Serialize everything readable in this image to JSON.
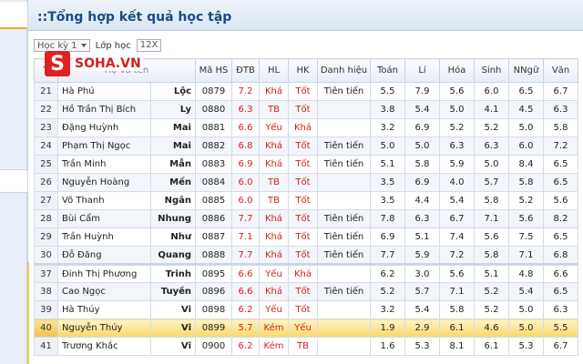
{
  "title": "::Tổng hợp kết quả học tập",
  "toolbar": {
    "semester_label": "Học kỳ 1",
    "class_label": "Lớp học",
    "class_value": "12X"
  },
  "logo": {
    "letter": "S",
    "text": "SOHA.VN"
  },
  "columns": {
    "stt": "T",
    "name": "Họ và tên",
    "ma_hs": "Mã HS",
    "dtb": "ĐTB",
    "hl": "HL",
    "hk": "HK",
    "danh_hieu": "Danh hiệu",
    "toan": "Toán",
    "li": "Lí",
    "hoa": "Hóa",
    "sinh": "Sinh",
    "nngu": "NNgữ",
    "van": "Văn"
  },
  "rows": [
    {
      "stt": "21",
      "ho": "Hà Phú",
      "ten": "Lộc",
      "ma": "0879",
      "dtb": "7.2",
      "hl": "Khá",
      "hk": "Tốt",
      "dh": "Tiên tiến",
      "toan": "5.5",
      "li": "7.9",
      "hoa": "5.6",
      "sinh": "6.0",
      "nngu": "6.5",
      "van": "6.7"
    },
    {
      "stt": "22",
      "ho": "Hồ Trần Thị Bích",
      "ten": "Ly",
      "ma": "0880",
      "dtb": "6.3",
      "hl": "TB",
      "hk": "Tốt",
      "dh": "",
      "toan": "3.8",
      "li": "5.4",
      "hoa": "5.0",
      "sinh": "4.1",
      "nngu": "4.5",
      "van": "6.3"
    },
    {
      "stt": "23",
      "ho": "Đặng Huỳnh",
      "ten": "Mai",
      "ma": "0881",
      "dtb": "6.6",
      "hl": "Yếu",
      "hk": "Khá",
      "dh": "",
      "toan": "3.2",
      "li": "6.9",
      "hoa": "5.2",
      "sinh": "5.2",
      "nngu": "5.0",
      "van": "5.8"
    },
    {
      "stt": "24",
      "ho": "Phạm Thị Ngọc",
      "ten": "Mai",
      "ma": "0882",
      "dtb": "6.8",
      "hl": "Khá",
      "hk": "Tốt",
      "dh": "Tiên tiến",
      "toan": "5.0",
      "li": "5.0",
      "hoa": "6.3",
      "sinh": "6.3",
      "nngu": "6.0",
      "van": "7.2"
    },
    {
      "stt": "25",
      "ho": "Trần Minh",
      "ten": "Mẫn",
      "ma": "0883",
      "dtb": "6.9",
      "hl": "Khá",
      "hk": "Tốt",
      "dh": "Tiên tiến",
      "toan": "5.1",
      "li": "5.8",
      "hoa": "5.9",
      "sinh": "5.0",
      "nngu": "8.4",
      "van": "6.5"
    },
    {
      "stt": "26",
      "ho": "Nguyễn Hoàng",
      "ten": "Mến",
      "ma": "0884",
      "dtb": "6.0",
      "hl": "TB",
      "hk": "Tốt",
      "dh": "",
      "toan": "3.5",
      "li": "6.9",
      "hoa": "4.0",
      "sinh": "5.7",
      "nngu": "5.8",
      "van": "6.5"
    },
    {
      "stt": "27",
      "ho": "Võ Thanh",
      "ten": "Ngân",
      "ma": "0885",
      "dtb": "6.0",
      "hl": "TB",
      "hk": "Tốt",
      "dh": "",
      "toan": "3.5",
      "li": "4.4",
      "hoa": "5.4",
      "sinh": "5.8",
      "nngu": "5.2",
      "van": "5.6"
    },
    {
      "stt": "28",
      "ho": "Bùi Cẩm",
      "ten": "Nhung",
      "ma": "0886",
      "dtb": "7.7",
      "hl": "Khá",
      "hk": "Tốt",
      "dh": "Tiên tiến",
      "toan": "7.8",
      "li": "6.3",
      "hoa": "6.7",
      "sinh": "7.1",
      "nngu": "5.6",
      "van": "8.2"
    },
    {
      "stt": "29",
      "ho": "Trần Huỳnh",
      "ten": "Như",
      "ma": "0887",
      "dtb": "7.1",
      "hl": "Khá",
      "hk": "Tốt",
      "dh": "Tiên tiến",
      "toan": "6.9",
      "li": "5.1",
      "hoa": "7.4",
      "sinh": "5.6",
      "nngu": "7.5",
      "van": "6.5"
    },
    {
      "stt": "30",
      "ho": "Đỗ Đăng",
      "ten": "Quang",
      "ma": "0888",
      "dtb": "7.7",
      "hl": "Khá",
      "hk": "Tốt",
      "dh": "Tiên tiến",
      "toan": "7.7",
      "li": "5.9",
      "hoa": "7.2",
      "sinh": "5.8",
      "nngu": "7.1",
      "van": "6.8"
    },
    {
      "stt": "37",
      "ho": "Đinh Thị Phương",
      "ten": "Trinh",
      "ma": "0895",
      "dtb": "6.6",
      "hl": "Yếu",
      "hk": "Khá",
      "dh": "",
      "toan": "6.2",
      "li": "3.0",
      "hoa": "5.6",
      "sinh": "5.1",
      "nngu": "4.8",
      "van": "6.6"
    },
    {
      "stt": "38",
      "ho": "Cao Ngọc",
      "ten": "Tuyền",
      "ma": "0896",
      "dtb": "6.6",
      "hl": "Khá",
      "hk": "Tốt",
      "dh": "Tiên tiến",
      "toan": "5.2",
      "li": "5.7",
      "hoa": "7.1",
      "sinh": "5.2",
      "nngu": "5.4",
      "van": "6.5"
    },
    {
      "stt": "39",
      "ho": "Hà Thúy",
      "ten": "Vi",
      "ma": "0898",
      "dtb": "6.2",
      "hl": "Yếu",
      "hk": "Tốt",
      "dh": "",
      "toan": "3.2",
      "li": "5.4",
      "hoa": "5.8",
      "sinh": "5.2",
      "nngu": "5.0",
      "van": "6.3"
    },
    {
      "stt": "40",
      "ho": "Nguyễn Thúy",
      "ten": "Vi",
      "ma": "0899",
      "dtb": "5.7",
      "hl": "Kém",
      "hk": "Yếu",
      "dh": "",
      "toan": "1.9",
      "li": "2.9",
      "hoa": "6.1",
      "sinh": "4.6",
      "nngu": "5.0",
      "van": "5.5"
    },
    {
      "stt": "41",
      "ho": "Trương Khắc",
      "ten": "Vĩ",
      "ma": "0900",
      "dtb": "6.2",
      "hl": "Kém",
      "hk": "TB",
      "dh": "",
      "toan": "1.6",
      "li": "5.3",
      "hoa": "8.1",
      "sinh": "6.1",
      "nngu": "5.3",
      "van": "6.7"
    }
  ],
  "highlight_row": "40",
  "colors": {
    "red_value": "#d81e1e",
    "highlight": "#fbd76a",
    "title": "#1b4b86"
  }
}
